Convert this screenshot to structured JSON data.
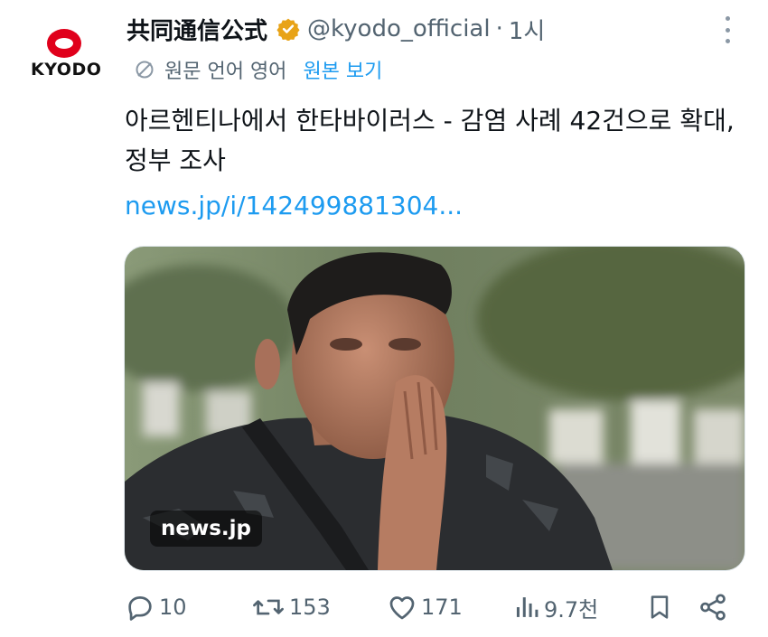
{
  "account": {
    "display_name": "共同通信公式",
    "handle": "@kyodo_official",
    "separator": "·",
    "time": "1시",
    "avatar_text": "KYODO",
    "verified": true
  },
  "translation": {
    "label": "원문 언어 영어",
    "link": "원본 보기"
  },
  "tweet": {
    "text": "아르헨티나에서 한타바이러스 - 감염 사례 42건으로 확대, 정부 조사",
    "link": "news.jp/i/142499881304..."
  },
  "media": {
    "source_label": "news.jp"
  },
  "actions": {
    "replies": "10",
    "retweets": "153",
    "likes": "171",
    "views": "9.7천"
  },
  "colors": {
    "link": "#1d9bf0",
    "secondary_text": "#536471",
    "verified_badge": "#e8a317",
    "logo_red": "#e0001b"
  },
  "icons": [
    "kyodo-logo",
    "verified-badge-icon",
    "more-icon",
    "translate-icon",
    "reply-icon",
    "retweet-icon",
    "like-icon",
    "views-icon",
    "bookmark-icon",
    "share-icon"
  ]
}
